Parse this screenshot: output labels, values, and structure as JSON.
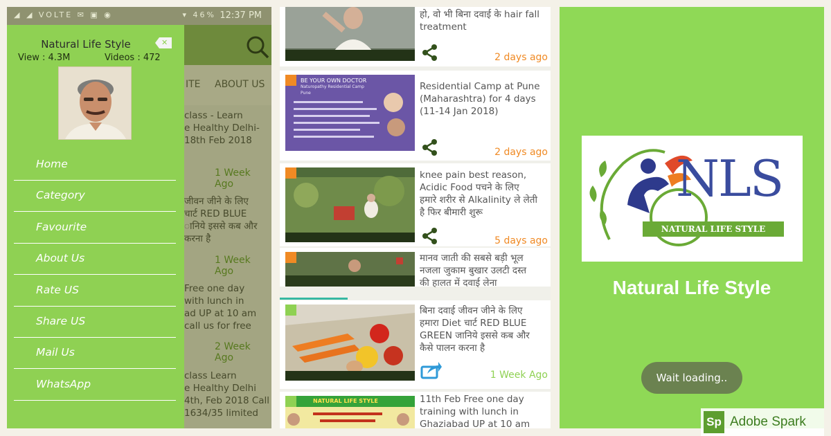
{
  "status_bar": {
    "network": "VOLTE",
    "battery": "46%",
    "time": "12:37 PM"
  },
  "drawer": {
    "title": "Natural Life Style",
    "views": "View : 4.3M",
    "videos": "Videos : 472",
    "menu": [
      "Home",
      "Category",
      "Favourite",
      "About Us",
      "Rate US",
      "Share US",
      "Mail Us",
      "WhatsApp"
    ]
  },
  "background_screen": {
    "tabs": [
      "ITE",
      "ABOUT US"
    ],
    "items": [
      {
        "lines": [
          "class - Learn",
          "e Healthy Delhi-",
          "18th Feb 2018"
        ],
        "time": "1 Week Ago"
      },
      {
        "lines": [
          "जीवन जीने के लिए",
          "चार्ट RED BLUE",
          "ानिये इससे कब और",
          "करना है"
        ],
        "time": "1 Week Ago"
      },
      {
        "lines": [
          "Free one day",
          "with lunch in",
          "ad UP at 10 am",
          "call us for free"
        ],
        "time": "2 Week Ago"
      },
      {
        "lines": [
          "class Learn",
          "e Healthy Delhi",
          "4th, Feb 2018 Call",
          "1634/35 limited"
        ],
        "time": ""
      }
    ]
  },
  "video_list": [
    {
      "title_lines": [
        "हो, वो भी बिना दवाई के hair fall",
        "treatment"
      ],
      "time": "2 days ago",
      "corner": "#f08a24"
    },
    {
      "title_lines": [
        "Residential Camp at Pune",
        "(Maharashtra) for 4 days",
        "(11-14 Jan 2018)"
      ],
      "time": "2 days ago",
      "corner": "#f08a24",
      "thumb_text": [
        "BE YOUR OWN DOCTOR",
        "Naturopathy Residential Camp",
        "Pune"
      ]
    },
    {
      "title_lines": [
        "knee pain best reason,",
        "Acidic Food पचने के  लिए",
        "हमारे शरीर से Alkalinity ले लेती",
        "है फिर बीमारी शुरू"
      ],
      "time": "5 days ago",
      "corner": "#f08a24"
    },
    {
      "title_lines": [
        "मानव जाती की सबसे बड़ी भूल",
        "नजला जुकाम बुखार उलटी दस्त",
        "की हालत में दवाई लेना"
      ],
      "time": "",
      "corner": "#f08a24"
    },
    {
      "title_lines": [
        "बिना दवाई जीवन जीने के लिए",
        "हमारा Diet चार्ट RED BLUE",
        "GREEN जानिये इससे कब और",
        "कैसे पालन करना है"
      ],
      "time": "1 Week Ago",
      "corner": "#8fd153"
    },
    {
      "title_lines": [
        "11th Feb Free one day",
        "training with lunch in",
        "Ghaziabad UP at 10 am"
      ],
      "time": "",
      "corner": "#8fd153",
      "thumb_text": [
        "NATURAL LIFE STYLE"
      ]
    }
  ],
  "splash": {
    "logo_letters": "NLS",
    "logo_tagline": "NATURAL LIFE STYLE",
    "app_name": "Natural Life Style",
    "loading_label": "Wait loading..",
    "watermark_badge": "Sp",
    "watermark_text": "Adobe Spark"
  },
  "colors": {
    "green": "#8fd153",
    "orange": "#f08a24",
    "time_orange": "#f08a24",
    "time_green": "#8fd153"
  }
}
